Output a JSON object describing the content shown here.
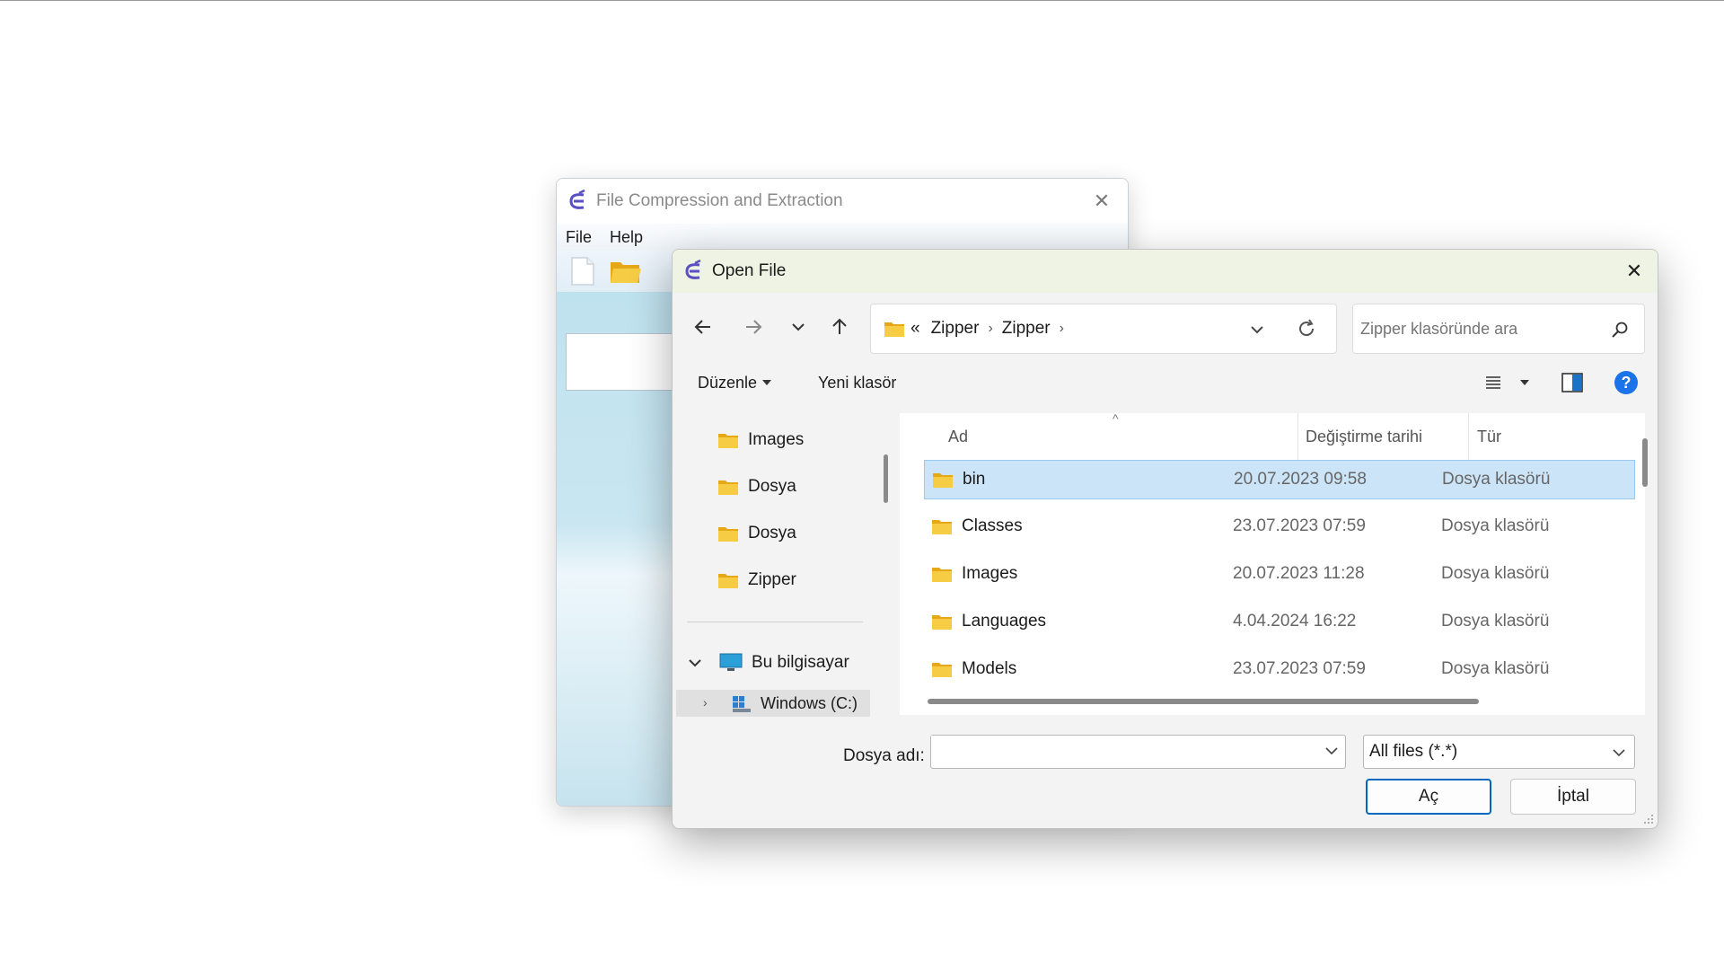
{
  "app": {
    "title": "File Compression and Extraction",
    "menu": [
      "File",
      "Help"
    ]
  },
  "dialog": {
    "title": "Open File",
    "address": {
      "overflow": "«",
      "path": [
        "Zipper",
        "Zipper"
      ]
    },
    "search_placeholder": "Zipper klasöründe ara",
    "commands": {
      "organize": "Düzenle",
      "new_folder": "Yeni klasör"
    },
    "nav_items": [
      "Images",
      "Dosya",
      "Dosya",
      "Zipper"
    ],
    "nav_computer": "Bu bilgisayar",
    "nav_drive": "Windows (C:)",
    "columns": {
      "name": "Ad",
      "date": "Değiştirme tarihi",
      "type": "Tür"
    },
    "files": [
      {
        "name": "bin",
        "date": "20.07.2023 09:58",
        "type": "Dosya klasörü",
        "selected": true
      },
      {
        "name": "Classes",
        "date": "23.07.2023 07:59",
        "type": "Dosya klasörü",
        "selected": false
      },
      {
        "name": "Images",
        "date": "20.07.2023 11:28",
        "type": "Dosya klasörü",
        "selected": false
      },
      {
        "name": "Languages",
        "date": "4.04.2024 16:22",
        "type": "Dosya klasörü",
        "selected": false
      },
      {
        "name": "Models",
        "date": "23.07.2023 07:59",
        "type": "Dosya klasörü",
        "selected": false
      }
    ],
    "filename_label": "Dosya adı:",
    "filename_value": "",
    "filetype": "All files (*.*)",
    "open_button": "Aç",
    "cancel_button": "İptal"
  },
  "colors": {
    "folder": "#f4c542",
    "selection": "#cce4f7",
    "accent": "#0067c0",
    "app_logo": "#5b4fc4"
  }
}
